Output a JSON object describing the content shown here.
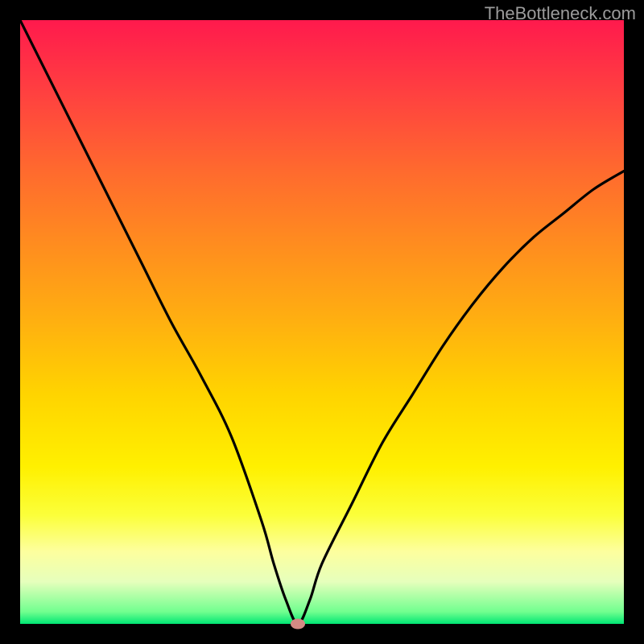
{
  "watermark": {
    "text": "TheBottleneck.com"
  },
  "chart_data": {
    "type": "line",
    "title": "",
    "xlabel": "",
    "ylabel": "",
    "xlim": [
      0,
      100
    ],
    "ylim": [
      0,
      100
    ],
    "series": [
      {
        "name": "bottleneck-curve",
        "x": [
          0,
          5,
          10,
          15,
          20,
          25,
          30,
          35,
          40,
          42,
          44,
          46,
          48,
          50,
          55,
          60,
          65,
          70,
          75,
          80,
          85,
          90,
          95,
          100
        ],
        "y": [
          100,
          90,
          80,
          70,
          60,
          50,
          41,
          31,
          17,
          10,
          4,
          0,
          4,
          10,
          20,
          30,
          38,
          46,
          53,
          59,
          64,
          68,
          72,
          75
        ]
      }
    ],
    "marker": {
      "x": 46,
      "y": 0
    },
    "background_gradient": {
      "top": "#ff1a4d",
      "mid": "#ffd400",
      "bottom": "#00e673"
    }
  }
}
